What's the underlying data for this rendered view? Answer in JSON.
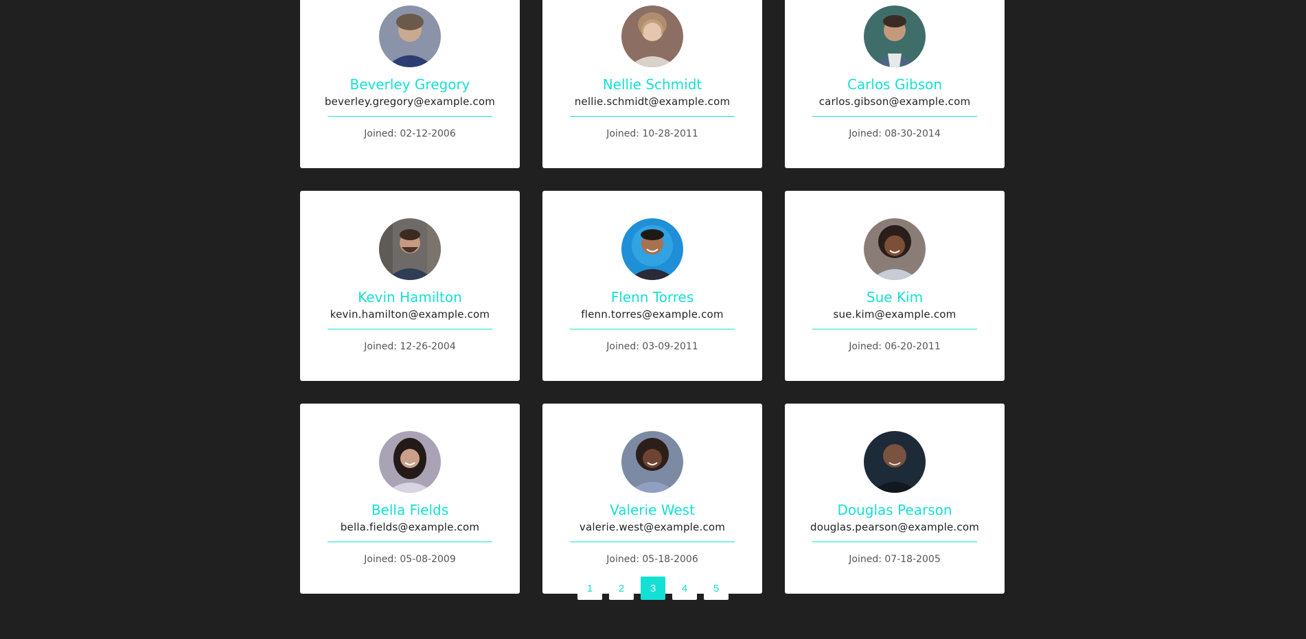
{
  "accent_color": "#15e0d5",
  "background_color": "#202020",
  "users": [
    {
      "name": "Beverley Gregory",
      "email": "beverley.gregory@example.com",
      "joined": "Joined: 02-12-2006",
      "avatar": "user-photo-icon"
    },
    {
      "name": "Nellie Schmidt",
      "email": "nellie.schmidt@example.com",
      "joined": "Joined: 10-28-2011",
      "avatar": "user-photo-icon"
    },
    {
      "name": "Carlos Gibson",
      "email": "carlos.gibson@example.com",
      "joined": "Joined: 08-30-2014",
      "avatar": "user-photo-icon"
    },
    {
      "name": "Kevin Hamilton",
      "email": "kevin.hamilton@example.com",
      "joined": "Joined: 12-26-2004",
      "avatar": "user-photo-icon"
    },
    {
      "name": "Flenn Torres",
      "email": "flenn.torres@example.com",
      "joined": "Joined: 03-09-2011",
      "avatar": "user-photo-icon"
    },
    {
      "name": "Sue Kim",
      "email": "sue.kim@example.com",
      "joined": "Joined: 06-20-2011",
      "avatar": "user-photo-icon"
    },
    {
      "name": "Bella Fields",
      "email": "bella.fields@example.com",
      "joined": "Joined: 05-08-2009",
      "avatar": "user-photo-icon"
    },
    {
      "name": "Valerie West",
      "email": "valerie.west@example.com",
      "joined": "Joined: 05-18-2006",
      "avatar": "user-photo-icon"
    },
    {
      "name": "Douglas Pearson",
      "email": "douglas.pearson@example.com",
      "joined": "Joined: 07-18-2005",
      "avatar": "user-photo-icon"
    }
  ],
  "pagination": {
    "pages": [
      "1",
      "2",
      "3",
      "4",
      "5"
    ],
    "current": "3"
  }
}
